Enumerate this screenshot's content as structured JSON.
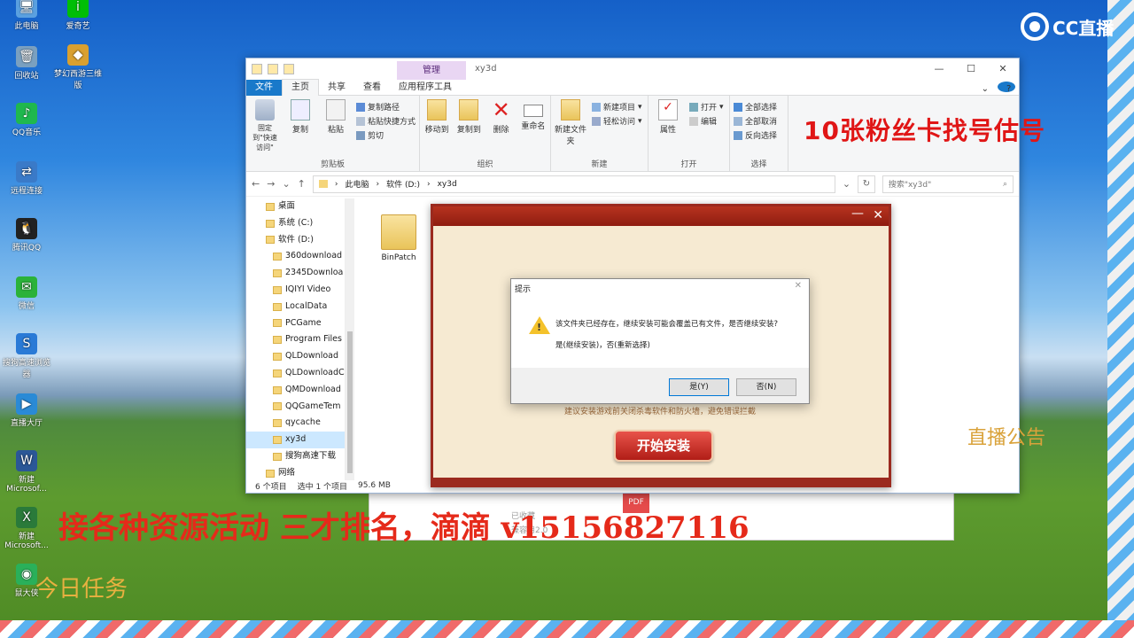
{
  "desktop": {
    "icons": [
      {
        "label": "此电脑",
        "glyph": "🖥",
        "color": "#5aa0e0"
      },
      {
        "label": "回收站",
        "glyph": "🗑",
        "color": "#7aa0c0"
      },
      {
        "label": "QQ音乐",
        "glyph": "♪",
        "color": "#1fb84e"
      },
      {
        "label": "远程连接",
        "glyph": "⇄",
        "color": "#3a7ac8"
      },
      {
        "label": "腾讯QQ",
        "glyph": "🐧",
        "color": "#222"
      },
      {
        "label": "微信",
        "glyph": "✉",
        "color": "#2bb23a"
      },
      {
        "label": "搜狗高速浏览器",
        "glyph": "S",
        "color": "#2a7ad6"
      },
      {
        "label": "直播大厅",
        "glyph": "▶",
        "color": "#2a8ad6"
      },
      {
        "label": "新建 Microsof...",
        "glyph": "W",
        "color": "#2b5797"
      },
      {
        "label": "新建 Microsoft...",
        "glyph": "X",
        "color": "#2a7a3a"
      },
      {
        "label": "鼠大侠",
        "glyph": "◉",
        "color": "#2ab05a"
      }
    ],
    "icons_col2": [
      {
        "label": "爱奇艺",
        "glyph": "i",
        "color": "#00be06"
      },
      {
        "label": "梦幻西游三维版",
        "glyph": "◆",
        "color": "#d9a030"
      }
    ]
  },
  "cc_logo": "CC直播",
  "overlay": {
    "top_right": "10张粉丝卡找号估号",
    "ad": "接各种资源活动 三才排名，滴滴 v15156827116",
    "notice": "直播公告",
    "today": "今日任务"
  },
  "explorer": {
    "manage_tab": "管理",
    "title": "xy3d",
    "tabs": [
      "文件",
      "主页",
      "共享",
      "查看",
      "应用程序工具"
    ],
    "ribbon": {
      "clipboard": {
        "pin": "固定到\"快速访问\"",
        "copy": "复制",
        "paste": "粘贴",
        "copy_path": "复制路径",
        "paste_shortcut": "粘贴快捷方式",
        "cut": "剪切",
        "name": "剪贴板"
      },
      "organize": {
        "move": "移动到",
        "copy_to": "复制到",
        "delete": "删除",
        "rename": "重命名",
        "name": "组织"
      },
      "new": {
        "new_folder": "新建文件夹",
        "new_item": "新建项目",
        "easy_access": "轻松访问",
        "name": "新建"
      },
      "open": {
        "properties": "属性",
        "open": "打开",
        "edit": "编辑",
        "name": "打开"
      },
      "select": {
        "select_all": "全部选择",
        "select_none": "全部取消",
        "invert": "反向选择",
        "name": "选择"
      }
    },
    "address": {
      "path": [
        "此电脑",
        "软件 (D:)",
        "xy3d"
      ],
      "search_placeholder": "搜索\"xy3d\""
    },
    "nav_items": [
      {
        "label": "桌面",
        "indent": 1
      },
      {
        "label": "系统 (C:)",
        "indent": 1
      },
      {
        "label": "软件 (D:)",
        "indent": 1
      },
      {
        "label": "360download",
        "indent": 2
      },
      {
        "label": "2345Downloa",
        "indent": 2
      },
      {
        "label": "IQIYI Video",
        "indent": 2
      },
      {
        "label": "LocalData",
        "indent": 2
      },
      {
        "label": "PCGame",
        "indent": 2
      },
      {
        "label": "Program Files",
        "indent": 2
      },
      {
        "label": "QLDownload",
        "indent": 2
      },
      {
        "label": "QLDownloadC",
        "indent": 2
      },
      {
        "label": "QMDownload",
        "indent": 2
      },
      {
        "label": "QQGameTem",
        "indent": 2
      },
      {
        "label": "qycache",
        "indent": 2
      },
      {
        "label": "xy3d",
        "indent": 2,
        "selected": true
      },
      {
        "label": "搜狗高速下载",
        "indent": 2
      },
      {
        "label": "网络",
        "indent": 1
      }
    ],
    "file": "BinPatch",
    "status": {
      "count": "6 个项目",
      "selected": "选中 1 个项目",
      "size": "95.6 MB"
    }
  },
  "installer": {
    "tip": "建议安装游戏前关闭杀毒软件和防火墙，避免错误拦截",
    "button": "开始安装"
  },
  "dialog": {
    "title": "提示",
    "message1": "该文件夹已经存在，继续安装可能会覆盖已有文件，是否继续安装?",
    "message2": "是(继续安装)，否(重新选择)",
    "yes": "是(Y)",
    "no": "否(N)"
  },
  "bg_window": {
    "pdf": "PDF",
    "line1": "已收藏",
    "line2": "兼容用2.0"
  }
}
